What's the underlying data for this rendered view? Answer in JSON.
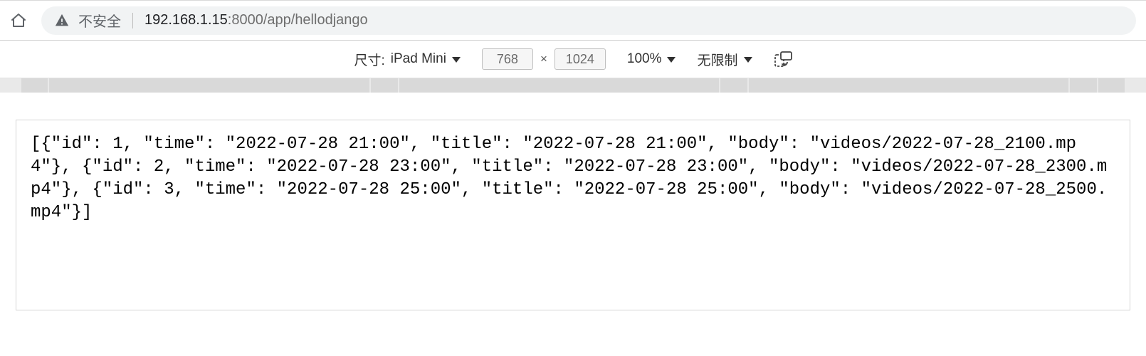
{
  "browser": {
    "insecure_label": "不安全",
    "url_host": "192.168.1.15",
    "url_path": ":8000/app/hellodjango"
  },
  "device_toolbar": {
    "dimensions_label": "尺寸:",
    "device_name": "iPad Mini",
    "width": "768",
    "height": "1024",
    "zoom": "100%",
    "throttling": "无限制"
  },
  "page_body": "[{\"id\": 1, \"time\": \"2022-07-28 21:00\", \"title\": \"2022-07-28 21:00\", \"body\": \"videos/2022-07-28_2100.mp4\"}, {\"id\": 2, \"time\": \"2022-07-28 23:00\", \"title\": \"2022-07-28 23:00\", \"body\": \"videos/2022-07-28_2300.mp4\"}, {\"id\": 3, \"time\": \"2022-07-28 25:00\", \"title\": \"2022-07-28 25:00\", \"body\": \"videos/2022-07-28_2500.mp4\"}]"
}
